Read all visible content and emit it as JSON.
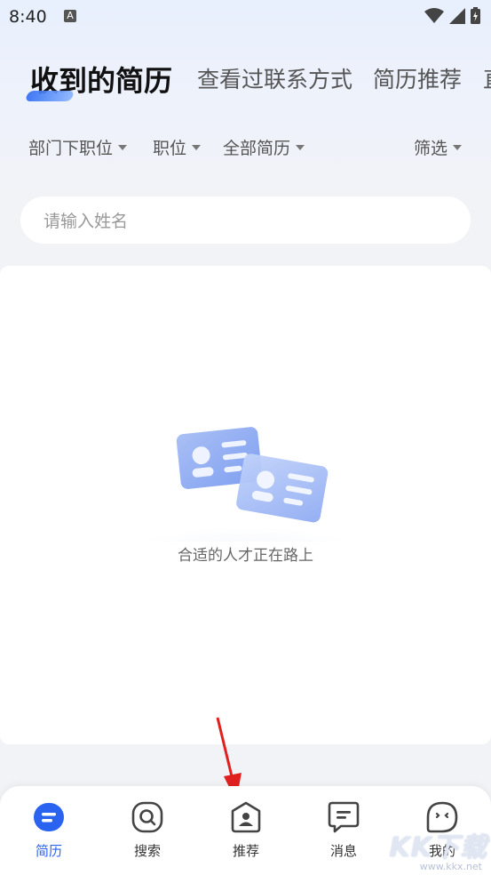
{
  "status": {
    "time": "8:40",
    "notif": "A"
  },
  "tabs": [
    {
      "label": "收到的简历"
    },
    {
      "label": "查看过联系方式"
    },
    {
      "label": "简历推荐"
    },
    {
      "label": "直"
    }
  ],
  "filters": [
    {
      "label": "部门下职位"
    },
    {
      "label": "职位"
    },
    {
      "label": "全部简历"
    },
    {
      "label": "筛选"
    }
  ],
  "search": {
    "placeholder": "请输入姓名"
  },
  "empty": {
    "text": "合适的人才正在路上"
  },
  "nav": [
    {
      "label": "简历",
      "icon": "resume-icon"
    },
    {
      "label": "搜索",
      "icon": "search-icon"
    },
    {
      "label": "推荐",
      "icon": "recommend-icon"
    },
    {
      "label": "消息",
      "icon": "message-icon"
    },
    {
      "label": "我的",
      "icon": "profile-icon"
    }
  ],
  "watermark": {
    "text": "KK下载",
    "url": "www.kkx.net"
  },
  "colors": {
    "accent": "#2a63f0",
    "text_muted": "#666666"
  }
}
